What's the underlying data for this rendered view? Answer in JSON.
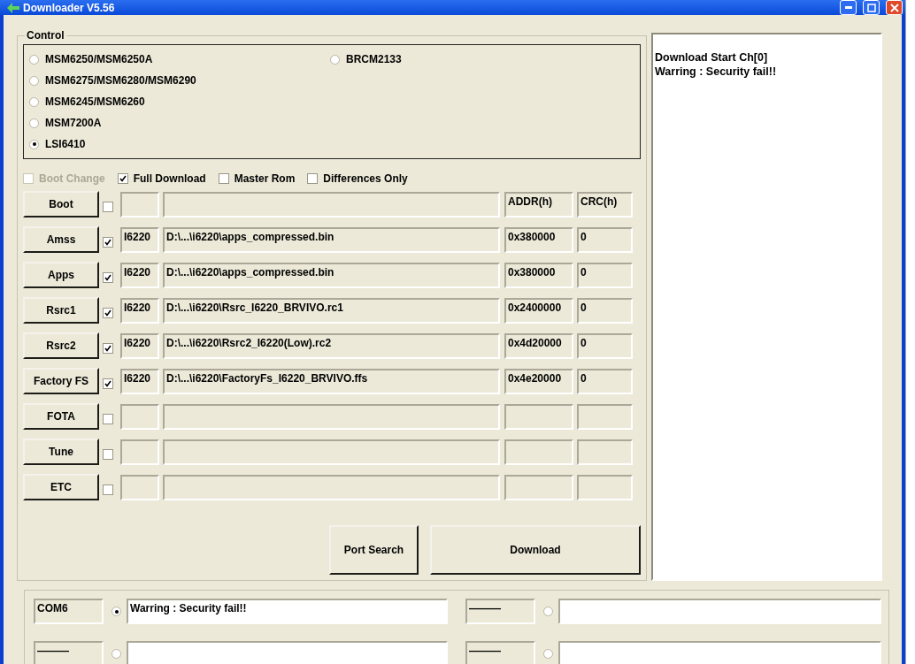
{
  "window": {
    "title": "Downloader V5.56"
  },
  "control": {
    "legend": "Control",
    "chip_columns": [
      [
        {
          "label": "MSM6250/MSM6250A",
          "selected": false
        },
        {
          "label": "MSM6275/MSM6280/MSM6290",
          "selected": false
        },
        {
          "label": "MSM6245/MSM6260",
          "selected": false
        },
        {
          "label": "MSM7200A",
          "selected": false
        },
        {
          "label": "LSI6410",
          "selected": true
        }
      ],
      [
        {
          "label": "BRCM2133",
          "selected": false
        }
      ]
    ],
    "options": [
      {
        "label": "Boot Change",
        "checked": false,
        "disabled": true
      },
      {
        "label": "Full Download",
        "checked": true,
        "disabled": false
      },
      {
        "label": "Master Rom",
        "checked": false,
        "disabled": false
      },
      {
        "label": "Differences Only",
        "checked": false,
        "disabled": false
      }
    ],
    "rows": [
      {
        "button": "Boot",
        "checked": false,
        "addr": "ADDR(h)",
        "crc": "CRC(h)"
      },
      {
        "button": "Amss",
        "checked": true,
        "model": "I6220",
        "path": "D:\\...\\i6220\\apps_compressed.bin",
        "addr": "0x380000",
        "crc": "0"
      },
      {
        "button": "Apps",
        "checked": true,
        "model": "I6220",
        "path": "D:\\...\\i6220\\apps_compressed.bin",
        "addr": "0x380000",
        "crc": "0"
      },
      {
        "button": "Rsrc1",
        "checked": true,
        "model": "I6220",
        "path": "D:\\...\\i6220\\Rsrc_I6220_BRVIVO.rc1",
        "addr": "0x2400000",
        "crc": "0"
      },
      {
        "button": "Rsrc2",
        "checked": true,
        "model": "I6220",
        "path": "D:\\...\\i6220\\Rsrc2_I6220(Low).rc2",
        "addr": "0x4d20000",
        "crc": "0"
      },
      {
        "button": "Factory FS",
        "checked": true,
        "model": "I6220",
        "path": "D:\\...\\i6220\\FactoryFs_I6220_BRVIVO.ffs",
        "addr": "0x4e20000",
        "crc": "0"
      },
      {
        "button": "FOTA",
        "checked": false
      },
      {
        "button": "Tune",
        "checked": false
      },
      {
        "button": "ETC",
        "checked": false
      }
    ],
    "buttons": [
      "Port Search",
      "Download"
    ]
  },
  "log": [
    "Download Start Ch[0]",
    "Warring : Security fail!!"
  ],
  "ports": [
    {
      "port": "COM6",
      "selected": true,
      "status": "Warring : Security fail!!"
    },
    {
      "port": "———",
      "selected": false
    },
    {
      "port": "———",
      "selected": false
    },
    {
      "port": "———",
      "selected": false
    }
  ]
}
